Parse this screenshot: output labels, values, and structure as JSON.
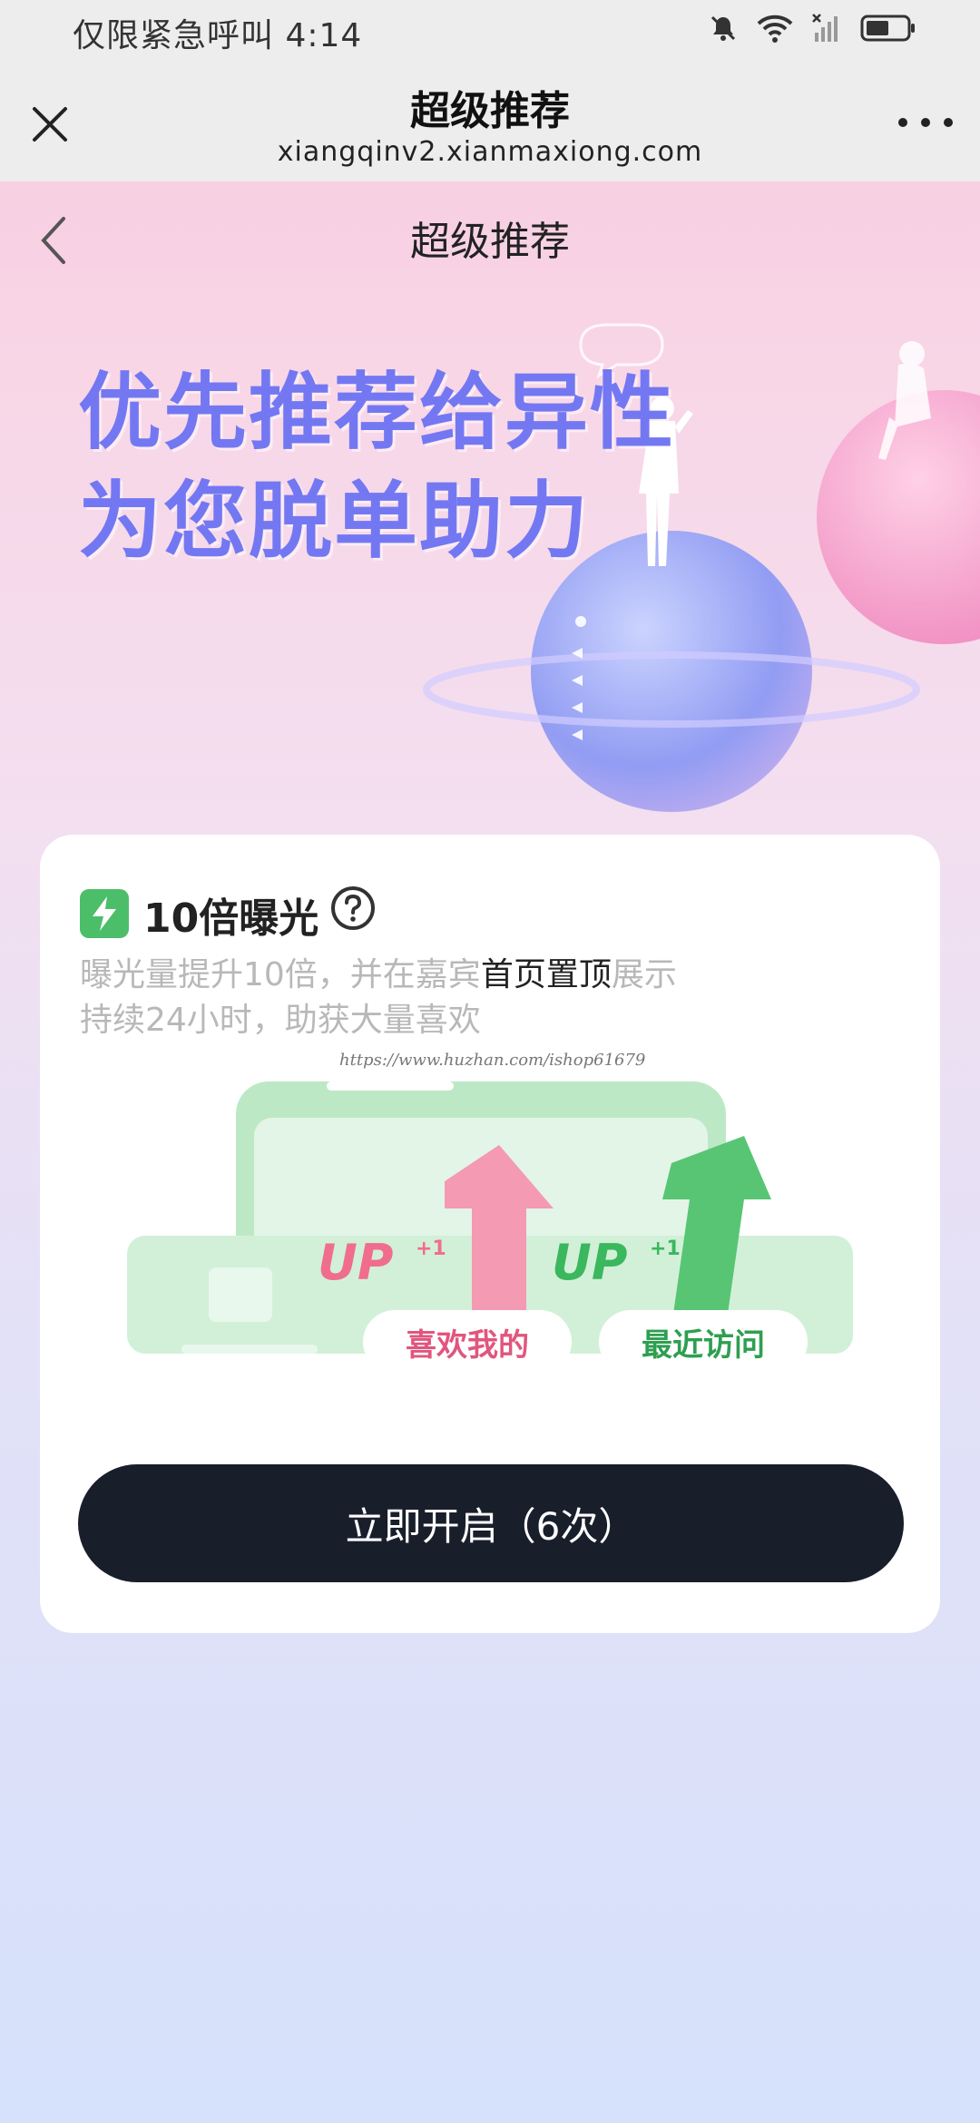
{
  "status": {
    "carrier_text": "仅限紧急呼叫",
    "time": "4:14"
  },
  "browser": {
    "title": "超级推荐",
    "url": "xiangqinv2.xianmaxiong.com"
  },
  "page": {
    "title": "超级推荐"
  },
  "hero": {
    "line1": "优先推荐给异性",
    "line2": "为您脱单助力"
  },
  "card": {
    "feature_title": "10倍曝光",
    "desc_part1": "曝光量提升10倍，并在嘉宾",
    "desc_highlight": "首页置顶",
    "desc_part2": "展示",
    "desc_line2": "持续24小时，助获大量喜欢",
    "watermark": "https://www.huzhan.com/ishop61679",
    "illustration": {
      "up_left": "UP",
      "up_right": "UP",
      "plus": "+1",
      "tag_left": "喜欢我的",
      "tag_right": "最近访问"
    },
    "cta_label": "立即开启（6次）"
  },
  "colors": {
    "accent_green": "#4cbe6a",
    "cta_bg": "#191e2b",
    "hero_text": "#7378f2",
    "up_pink": "#f06d8e"
  }
}
